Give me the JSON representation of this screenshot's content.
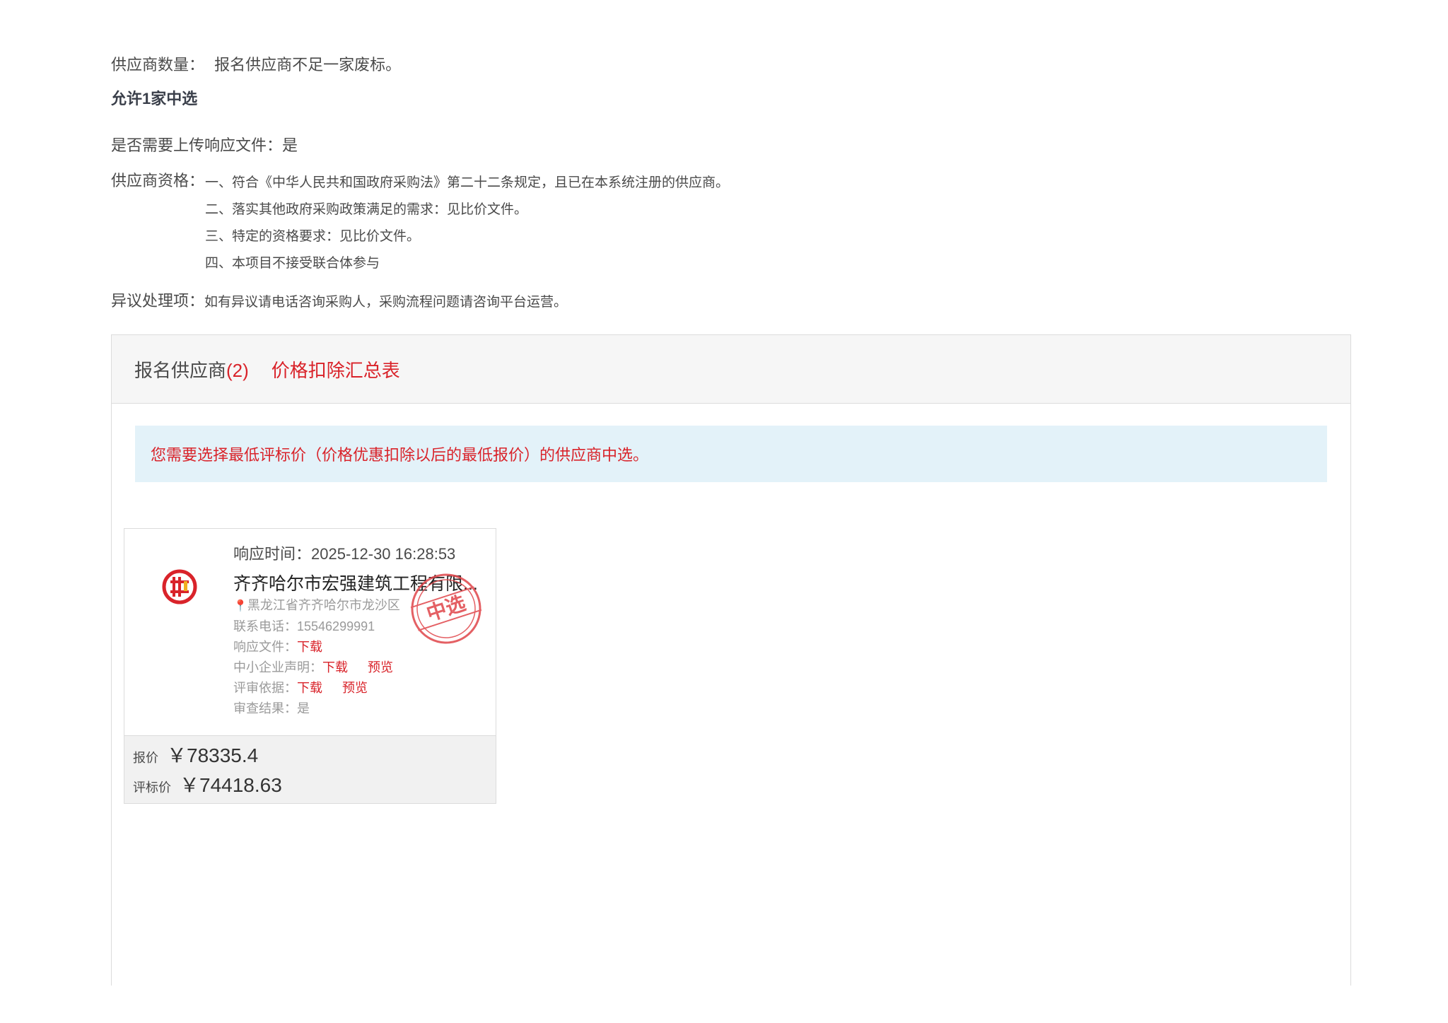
{
  "info": {
    "supplier_count_label": "供应商数量：",
    "supplier_count_value": "报名供应商不足一家废标。",
    "allow_winners": "允许1家中选",
    "upload_required": "是否需要上传响应文件：是",
    "qualification_label": "供应商资格：",
    "qualifications": [
      "一、符合《中华人民共和国政府采购法》第二十二条规定，且已在本系统注册的供应商。",
      "二、落实其他政府采购政策满足的需求：见比价文件。",
      "三、特定的资格要求：见比价文件。",
      "四、本项目不接受联合体参与"
    ],
    "objection_label": "异议处理项：",
    "objection_value": "如有异议请电话咨询采购人，采购流程问题请咨询平台运营。"
  },
  "panel": {
    "tab_suppliers": "报名供应商",
    "tab_suppliers_count": "(2)",
    "tab_price_table": "价格扣除汇总表",
    "notice": "您需要选择最低评标价（价格优惠扣除以后的最低报价）的供应商中选。"
  },
  "card": {
    "logo_icon": "company-logo-icon",
    "response_time": "响应时间：2025-12-30 16:28:53",
    "company_name": "齐齐哈尔市宏强建筑工程有限...",
    "location_icon": "map-pin-icon",
    "address": "黑龙江省齐齐哈尔市龙沙区",
    "phone": "联系电话：15546299991",
    "response_file_label": "响应文件：",
    "download": "下载",
    "preview": "预览",
    "sme_label": "中小企业声明：",
    "review_basis_label": "评审依据：",
    "review_result": "审查结果：是",
    "stamp_text": "中选",
    "quote_label": "报价",
    "quote_value": "￥78335.4",
    "eval_label": "评标价",
    "eval_value": "￥74418.63"
  },
  "colors": {
    "accent_red": "#d9232a",
    "notice_bg": "#e3f2f9",
    "panel_head_bg": "#f6f6f6"
  }
}
